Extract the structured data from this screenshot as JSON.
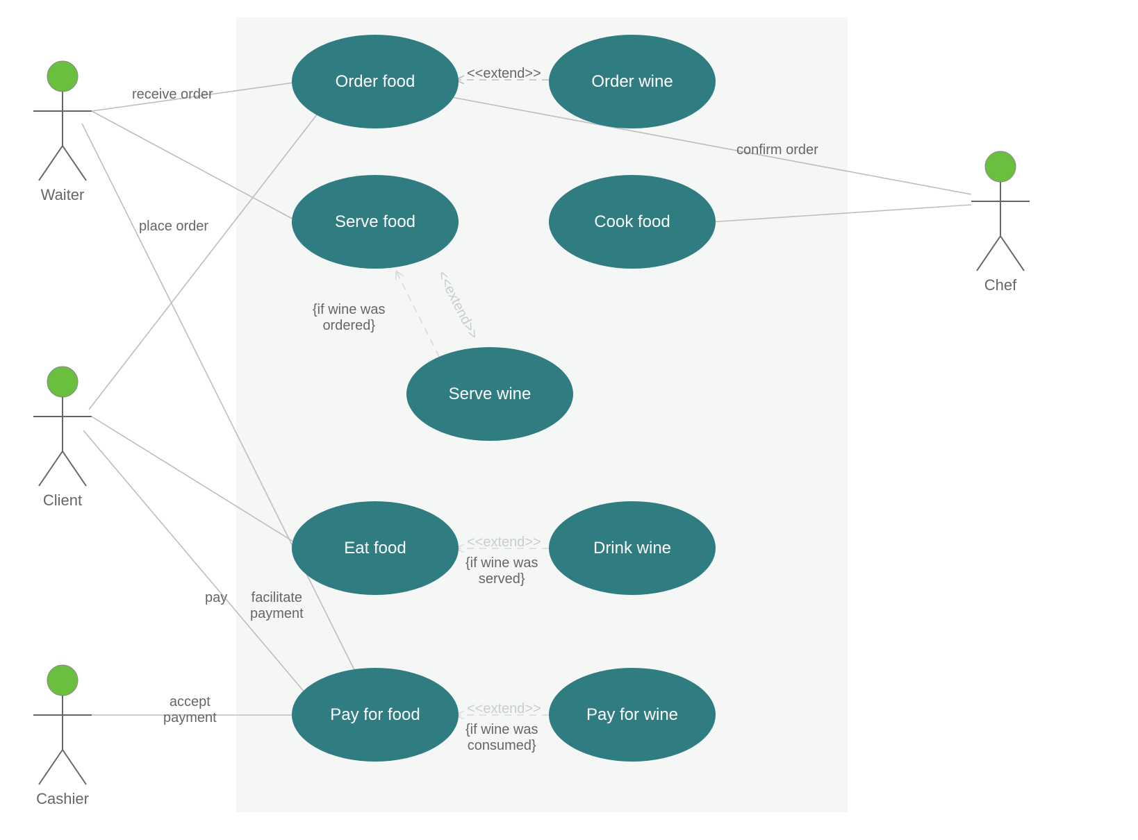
{
  "actors": {
    "waiter": {
      "label": "Waiter"
    },
    "client": {
      "label": "Client"
    },
    "cashier": {
      "label": "Cashier"
    },
    "chef": {
      "label": "Chef"
    }
  },
  "usecases": {
    "order_food": {
      "label": "Order food"
    },
    "order_wine": {
      "label": "Order wine"
    },
    "serve_food": {
      "label": "Serve food"
    },
    "cook_food": {
      "label": "Cook food"
    },
    "serve_wine": {
      "label": "Serve wine"
    },
    "eat_food": {
      "label": "Eat food"
    },
    "drink_wine": {
      "label": "Drink wine"
    },
    "pay_for_food": {
      "label": "Pay for food"
    },
    "pay_for_wine": {
      "label": "Pay for wine"
    }
  },
  "edge_labels": {
    "receive_order": "receive order",
    "place_order": "place order",
    "confirm_order": "confirm order",
    "pay": "pay",
    "facilitate_payment": "facilitate\npayment",
    "accept_payment": "accept\npayment",
    "extend1": "<<extend>>",
    "extend2": "<<extend>>",
    "extend3": "<<extend>>",
    "extend4": "<<extend>>",
    "guard_serve": "{if wine was\nordered}",
    "guard_drink": "{if wine was\nserved}",
    "guard_pay": "{if wine was\nconsumed}"
  }
}
